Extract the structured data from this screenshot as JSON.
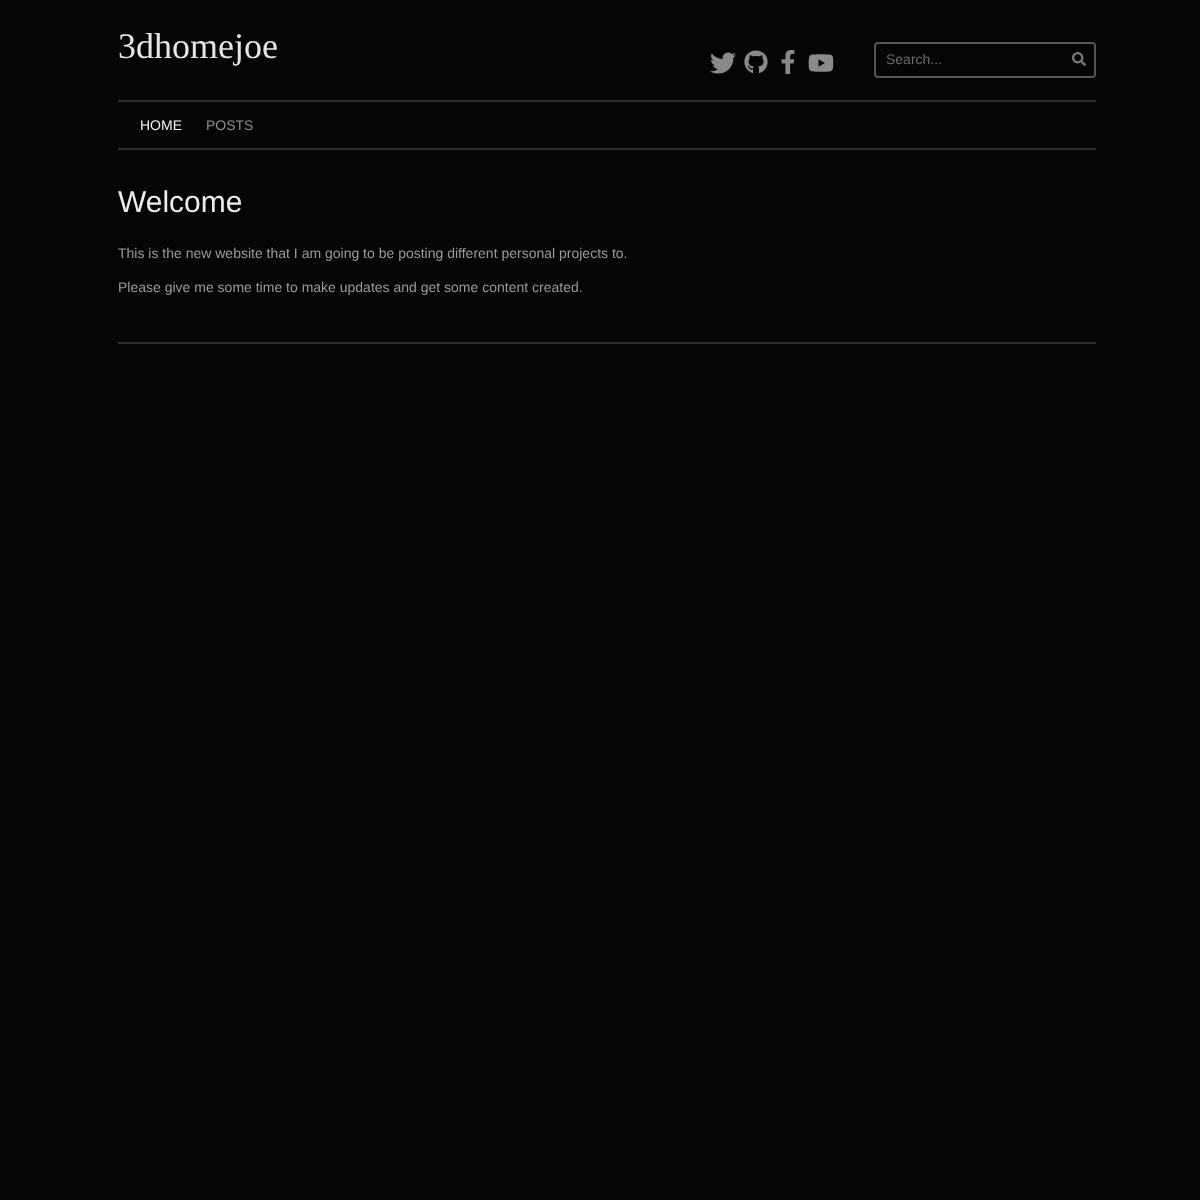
{
  "site_title": "3dhomejoe",
  "social_links": [
    {
      "kind": "twitter"
    },
    {
      "kind": "github"
    },
    {
      "kind": "facebook"
    },
    {
      "kind": "youtube"
    }
  ],
  "search": {
    "placeholder": "Search..."
  },
  "nav": [
    {
      "label": "HOME",
      "selected": true
    },
    {
      "label": "POSTS",
      "selected": false
    }
  ],
  "content": {
    "heading": "Welcome",
    "paragraphs": [
      "This is the new website that I am going to be posting different personal projects to.",
      "Please give me some time to make updates and get some content created."
    ]
  }
}
